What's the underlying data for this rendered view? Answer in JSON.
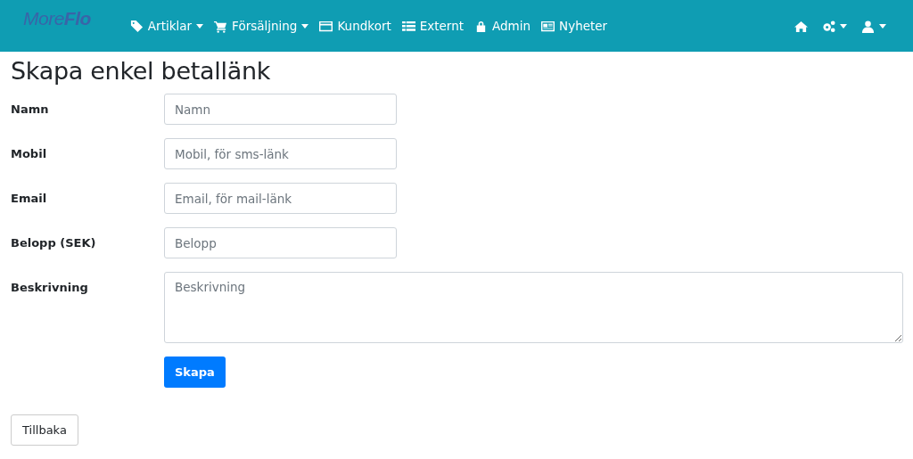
{
  "navbar": {
    "logo": "More**Flo**",
    "items": [
      {
        "kind": "tag",
        "label": "Artiklar",
        "dropdown": true
      },
      {
        "kind": "cart",
        "label": "Försäljning",
        "dropdown": true
      },
      {
        "kind": "card",
        "label": "Kundkort",
        "dropdown": false
      },
      {
        "kind": "list",
        "label": "Externt",
        "dropdown": false
      },
      {
        "kind": "lock",
        "label": "Admin",
        "dropdown": false
      },
      {
        "kind": "news",
        "label": "Nyheter",
        "dropdown": false
      }
    ],
    "right": [
      {
        "kind": "home",
        "dropdown": false
      },
      {
        "kind": "gears",
        "dropdown": true
      },
      {
        "kind": "user",
        "dropdown": true
      }
    ]
  },
  "title": "Skapa enkel betallänk",
  "fields": [
    {
      "label": "Namn",
      "placeholder": "Namn",
      "kind": "input"
    },
    {
      "label": "Mobil",
      "placeholder": "Mobil, för sms-länk",
      "kind": "input"
    },
    {
      "label": "Email",
      "placeholder": "Email, för mail-länk",
      "kind": "input"
    },
    {
      "label": "Belopp (SEK)",
      "placeholder": "Belopp",
      "kind": "input"
    },
    {
      "label": "Beskrivning",
      "placeholder": "Beskrivning",
      "kind": "textarea"
    }
  ],
  "submit": "Skapa",
  "back": "Tillbaka"
}
